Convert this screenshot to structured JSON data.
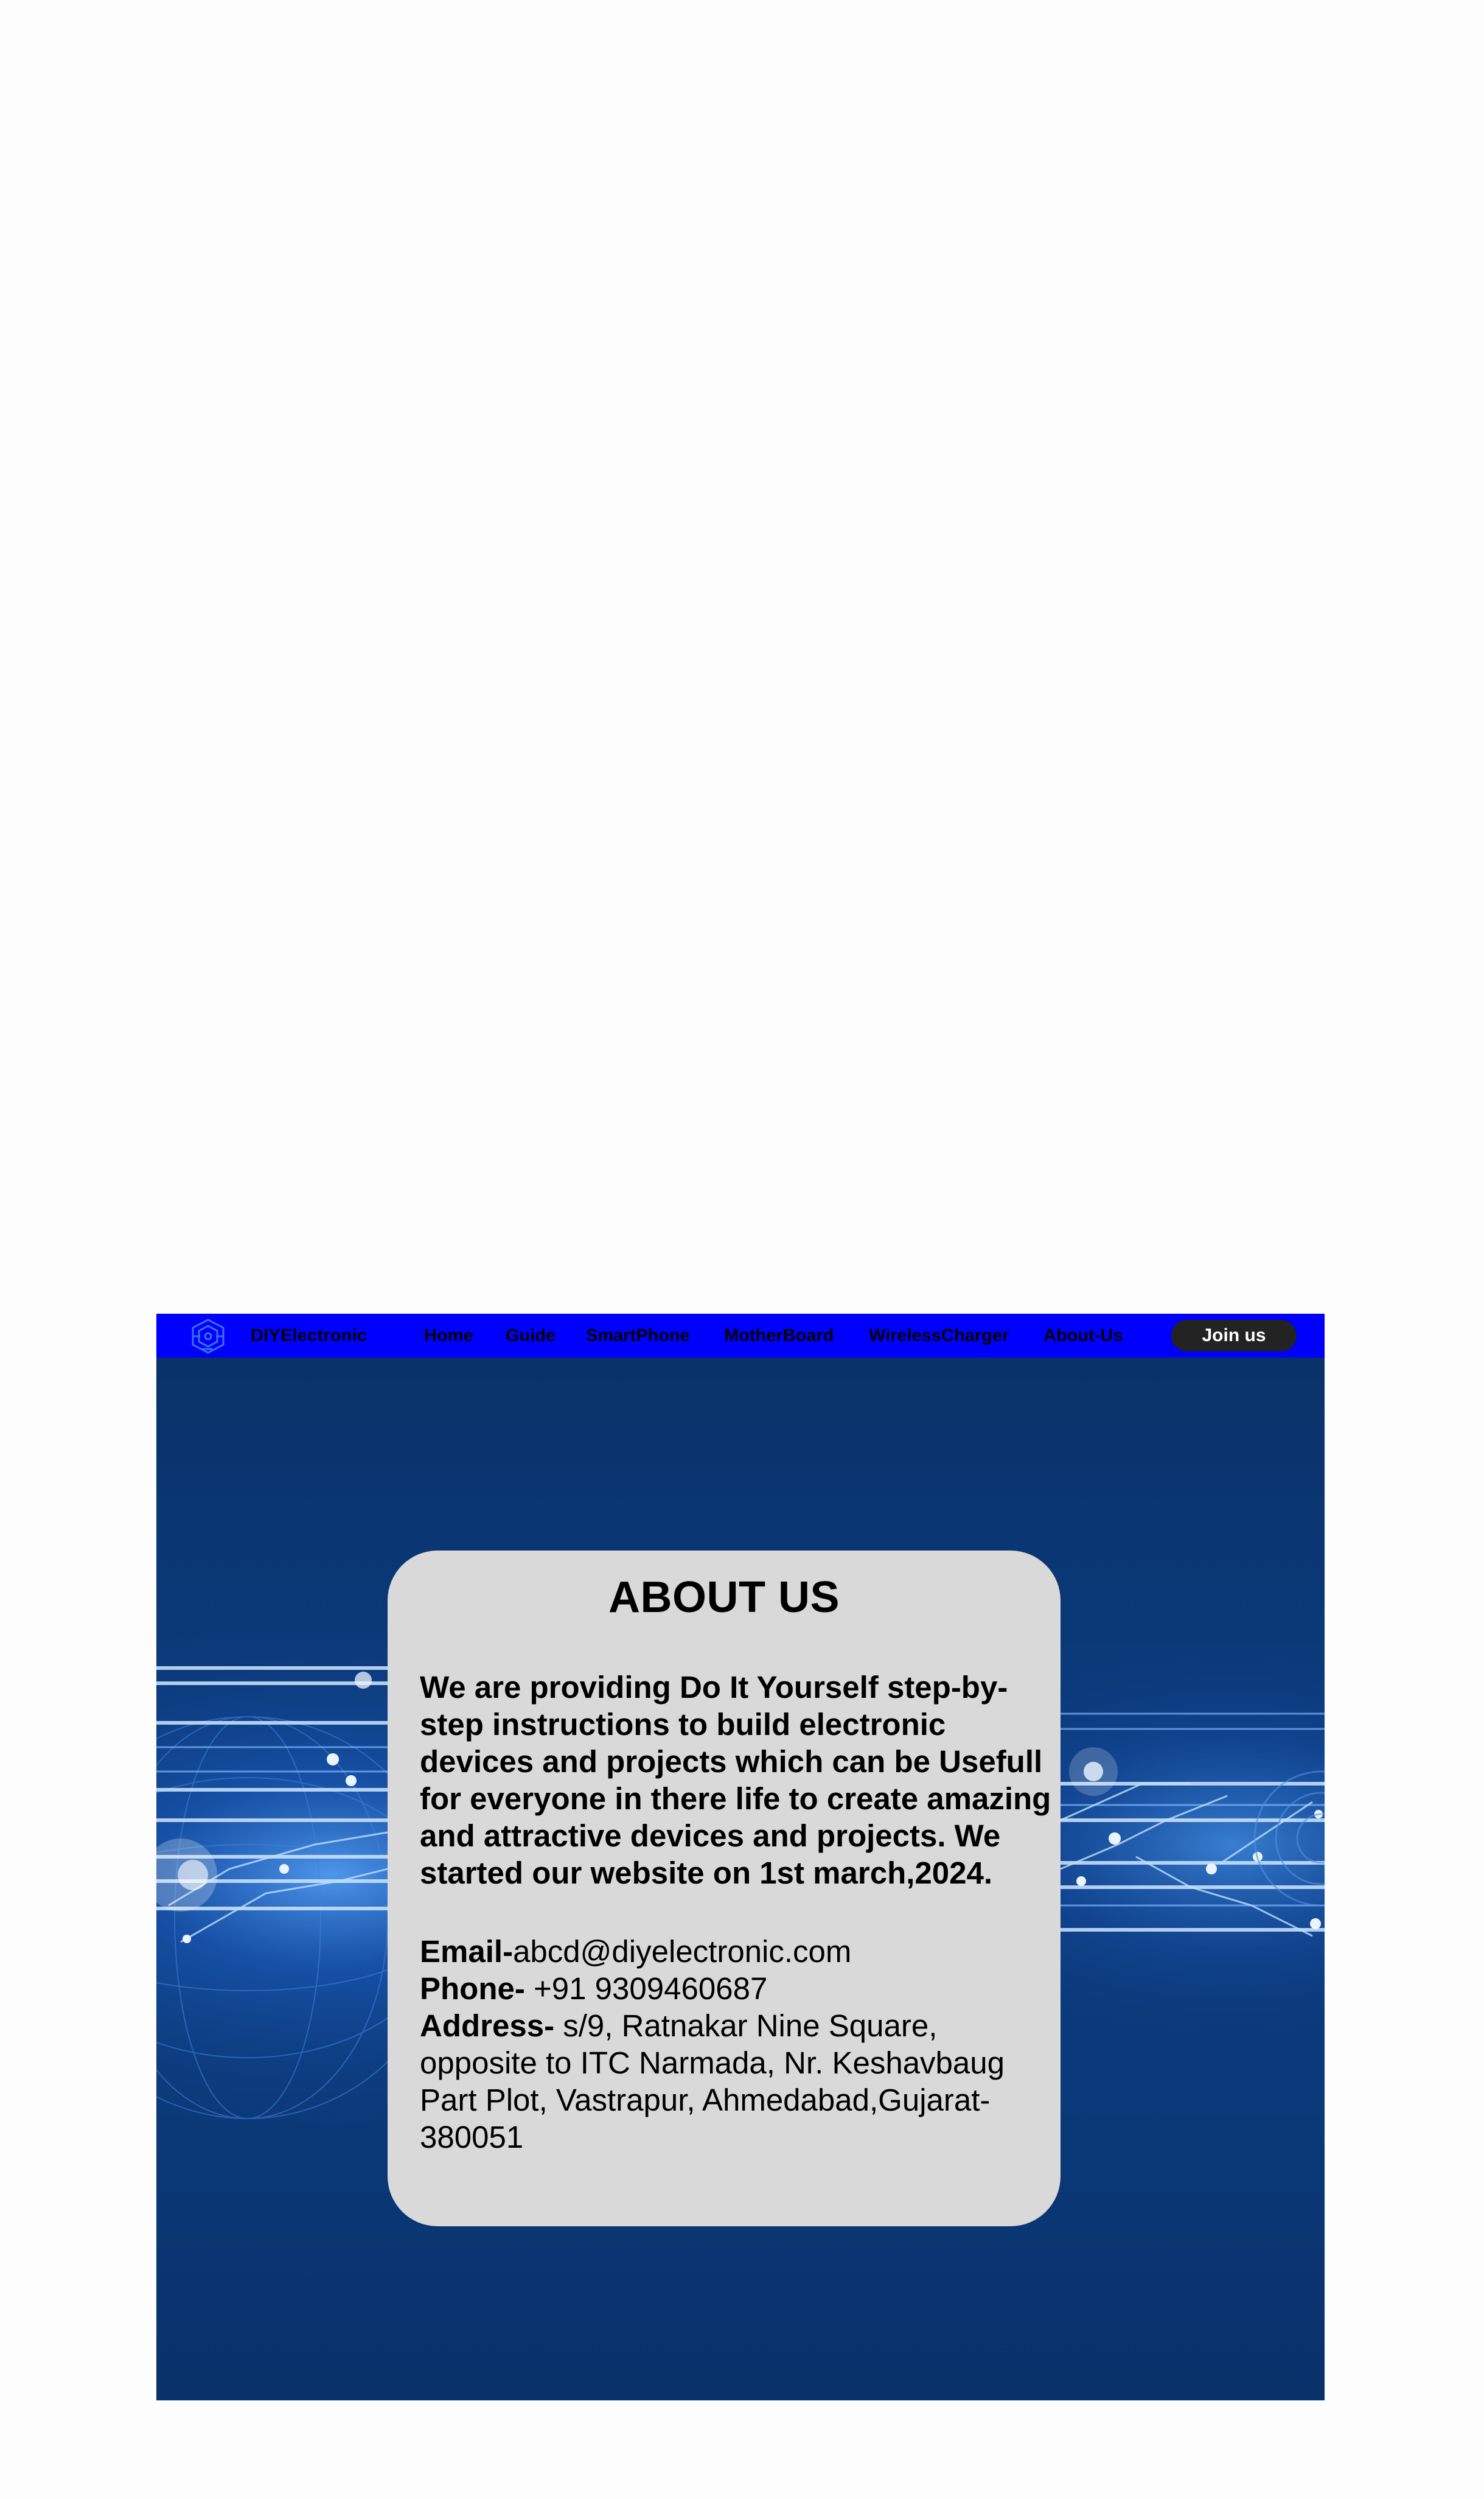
{
  "nav": {
    "brand": "DIYElectronic",
    "links": [
      "Home",
      "Guide",
      "SmartPhone",
      "MotherBoard",
      "WirelessCharger",
      "About-Us"
    ],
    "join_label": "Join us",
    "bg_color": "#0000ff",
    "join_bg": "#232323"
  },
  "about": {
    "title": "ABOUT US",
    "body": "We are providing Do It Yourself step-by-step instructions to build electronic devices and projects which can be Usefull for everyone in there life to create amazing and attractive devices and projects. We started our website on 1st march,2024.",
    "email_label": "Email-",
    "email": "abcd@diyelectronic.com",
    "phone_label": "Phone-",
    "phone": " +91 9309460687",
    "address_label": "Address-",
    "address": " s/9, Ratnakar Nine Square, opposite to ITC Narmada, Nr. Keshavbaug Part Plot, Vastrapur, Ahmedabad,Gujarat-380051",
    "card_bg": "#d9d9d9"
  },
  "hero": {
    "bg_color": "#0a3570",
    "icon": "network-globe-background"
  }
}
